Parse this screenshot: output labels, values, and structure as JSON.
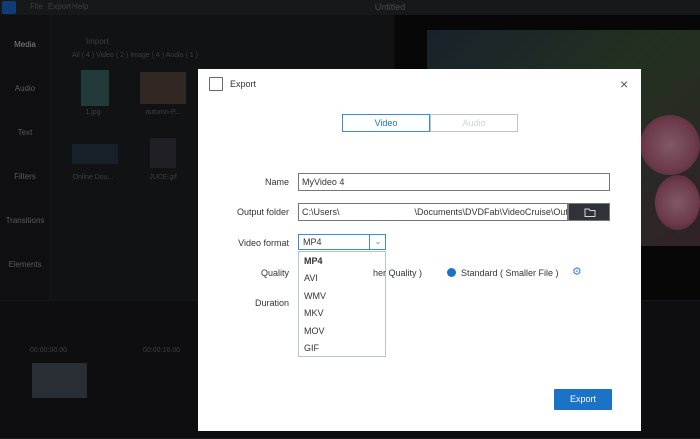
{
  "app": {
    "window_title": "Untitled",
    "menu": [
      "File",
      "Export",
      "Help"
    ],
    "nav": [
      "Media",
      "Audio",
      "Text",
      "Filters",
      "Transitions",
      "Elements"
    ],
    "media_header": "Import",
    "media_tabs": "All ( 4 )    Video ( 2 )    Image ( 4 )    Audio ( 1 )",
    "thumbs": [
      "1.jpg",
      "autumn-P...",
      "Online Dou...",
      "JUCE.gif"
    ],
    "ruler": [
      "00:00:00.00",
      "00:00:16.00"
    ]
  },
  "dialog": {
    "title": "Export",
    "close": "×",
    "tabs": {
      "video": "Video",
      "audio": "Audio"
    },
    "name_label": "Name",
    "name_value": "MyVideo  4",
    "folder_label": "Output folder",
    "folder_value": "C:\\Users\\                              \\Documents\\DVDFab\\VideoCruise\\Output",
    "format_label": "Video format",
    "format_value": "MP4",
    "format_options": [
      "MP4",
      "AVI",
      "WMV",
      "MKV",
      "MOV",
      "GIF"
    ],
    "quality_label": "Quality",
    "quality_hidden_text": "her Quality )",
    "quality_standard": "Standard ( Smaller File )",
    "duration_label": "Duration",
    "export_button": "Export"
  },
  "colors": {
    "accent": "#1a73c7",
    "dialog_bg": "#ffffff",
    "app_bg": "#17181a"
  }
}
